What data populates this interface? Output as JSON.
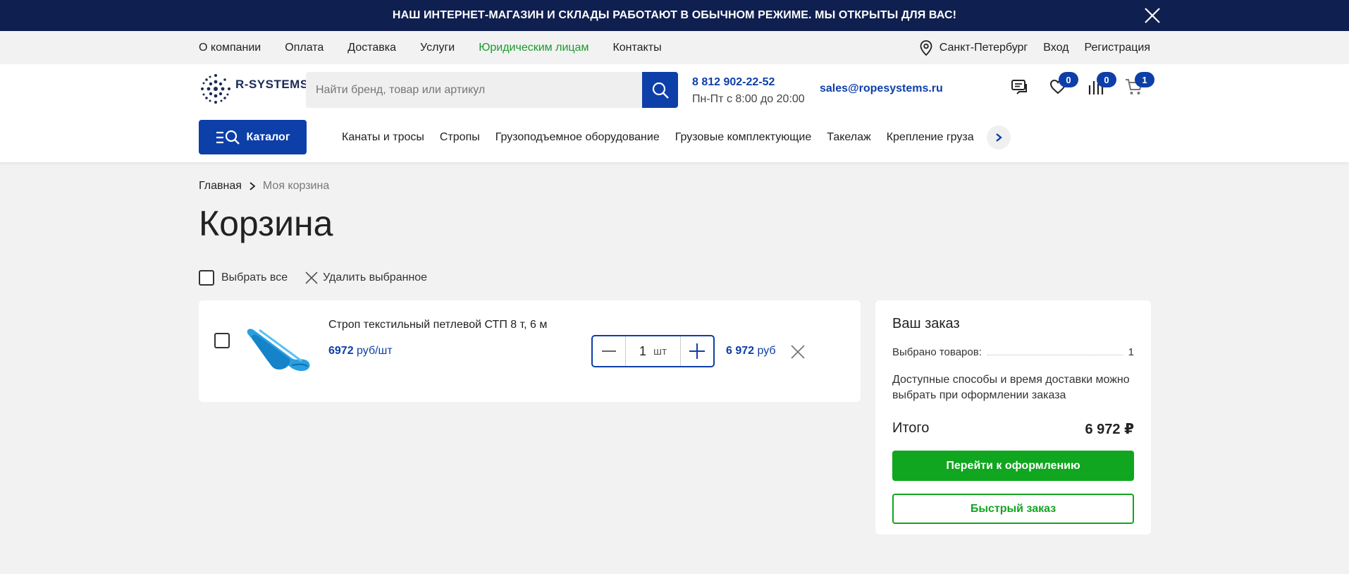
{
  "banner": {
    "text": "НАШ ИНТЕРНЕТ-МАГАЗИН И СКЛАДЫ РАБОТАЮТ В ОБЫЧНОМ РЕЖИМЕ. МЫ ОТКРЫТЫ ДЛЯ ВАС!",
    "close_icon": "close-icon"
  },
  "topnav": {
    "links": [
      "О компании",
      "Оплата",
      "Доставка",
      "Услуги",
      "Юридическим лицам",
      "Контакты"
    ],
    "city": "Санкт-Петербург",
    "login": "Вход",
    "register": "Регистрация"
  },
  "header": {
    "logo_text": "R-SYSTEMS",
    "search_placeholder": "Найти бренд, товар или артикул",
    "phone": "8 812 902-22-52",
    "hours": "Пн-Пт с 8:00 до 20:00",
    "email": "sales@ropesystems.ru",
    "favorites_count": "0",
    "compare_count": "0",
    "cart_count": "1"
  },
  "catalog": {
    "button_label": "Каталог",
    "links": [
      "Канаты и тросы",
      "Стропы",
      "Грузоподъемное оборудование",
      "Грузовые комплектующие",
      "Такелаж",
      "Крепление груза"
    ]
  },
  "breadcrumb": {
    "home": "Главная",
    "current": "Моя корзина"
  },
  "page_title": "Корзина",
  "actions": {
    "select_all": "Выбрать все",
    "delete_selected": "Удалить выбранное"
  },
  "cart_items": [
    {
      "title": "Строп текстильный петлевой СТП 8 т, 6 м",
      "unit_price": "6972",
      "unit_price_suffix": "руб/шт",
      "quantity": "1",
      "unit": "шт",
      "total": "6 972",
      "total_suffix": "руб"
    }
  ],
  "summary": {
    "title": "Ваш заказ",
    "selected_label": "Выбрано товаров:",
    "selected_count": "1",
    "note": "Доступные способы и время доставки можно выбрать при оформлении заказа",
    "total_label": "Итого",
    "total_value": "6 972 ₽",
    "checkout_label": "Перейти к оформлению",
    "quick_order_label": "Быстрый заказ"
  },
  "colors": {
    "brand_blue": "#0d3fa8",
    "banner_navy": "#0f1f4f",
    "green": "#10a61f",
    "link_green": "#1a9a2e"
  }
}
